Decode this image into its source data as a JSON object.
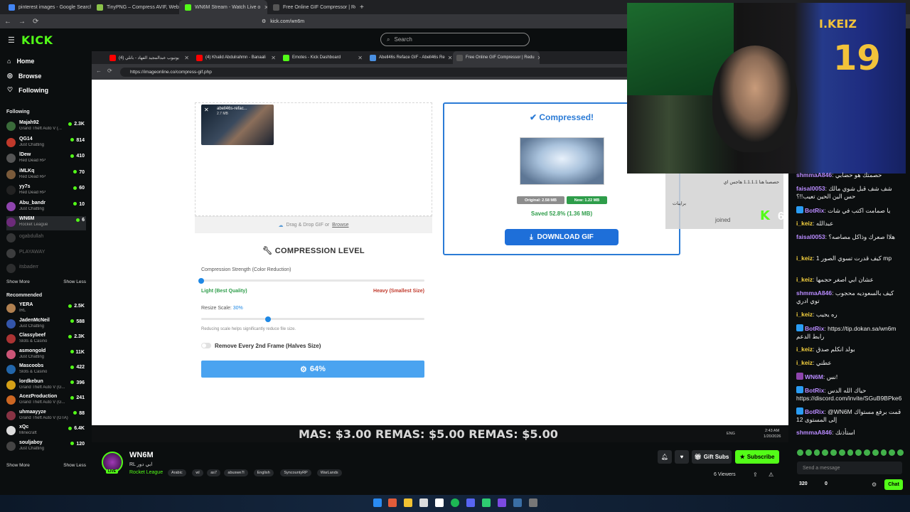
{
  "outer_tabs": [
    {
      "label": "pinterest images - Google Search",
      "color": "#4285f4"
    },
    {
      "label": "TinyPNG – Compress AVIF, WebP, PNG",
      "color": "#8bc34a"
    },
    {
      "label": "WN6M Stream - Watch Live o",
      "color": "#53fc18"
    },
    {
      "label": "Free Online GIF Compressor | Reduc",
      "color": "#555555"
    }
  ],
  "outer_url": "kick.com/wn6m",
  "kick": {
    "logo": "KICK",
    "search_placeholder": "Search"
  },
  "sidebar": {
    "nav": [
      {
        "label": "Home"
      },
      {
        "label": "Browse"
      },
      {
        "label": "Following"
      }
    ],
    "following_title": "Following",
    "following": [
      {
        "name": "Majah92",
        "game": "Grand Theft Auto V (...",
        "viewers": "2.3K",
        "color": "#3a6b3a"
      },
      {
        "name": "QG14",
        "game": "Just Chatting",
        "viewers": "814",
        "color": "#c0392b"
      },
      {
        "name": "lDew",
        "game": "Red Dead RP",
        "viewers": "410",
        "color": "#555555"
      },
      {
        "name": "iMLKq",
        "game": "Red Dead RP",
        "viewers": "70",
        "color": "#7a5a3a"
      },
      {
        "name": "yy7s",
        "game": "Red Dead RP",
        "viewers": "60",
        "color": "#222222"
      },
      {
        "name": "Abu_bandr",
        "game": "Just Chatting",
        "viewers": "10",
        "color": "#8e44ad"
      },
      {
        "name": "WN6M",
        "game": "Rocket League",
        "viewers": "6",
        "color": "#6d2b7a"
      }
    ],
    "offline": [
      {
        "name": "ogabdullah",
        "color": "#666666"
      },
      {
        "name": "PLAYAWAY",
        "color": "#777777"
      },
      {
        "name": "itsbaderr",
        "color": "#555555"
      }
    ],
    "show_more": "Show More",
    "show_less": "Show Less",
    "recommended_title": "Recommended",
    "recommended": [
      {
        "name": "YERA",
        "game": "IRL",
        "viewers": "2.5K",
        "color": "#b08050"
      },
      {
        "name": "JadenMcNeil",
        "game": "Just Chatting",
        "viewers": "588",
        "color": "#3355aa"
      },
      {
        "name": "Classybeef",
        "game": "Slots & Casino",
        "viewers": "2.3K",
        "color": "#aa3333"
      },
      {
        "name": "asmongold",
        "game": "Just Chatting",
        "viewers": "11K",
        "color": "#cc5577"
      },
      {
        "name": "Mascoobs",
        "game": "Slots & Casino",
        "viewers": "422",
        "color": "#2266aa"
      },
      {
        "name": "lordkebun",
        "game": "Grand Theft Auto V (G...",
        "viewers": "396",
        "color": "#d4a017"
      },
      {
        "name": "AcezProduction",
        "game": "Grand Theft Auto V (G...",
        "viewers": "241",
        "color": "#cc6622"
      },
      {
        "name": "uhmaayyze",
        "game": "Grand Theft Auto V (GTA)",
        "viewers": "88",
        "color": "#883344"
      },
      {
        "name": "xQc",
        "game": "Minecraft",
        "viewers": "6.4K",
        "color": "#dddddd"
      },
      {
        "name": "souljaboy",
        "game": "Just Chatting",
        "viewers": "120",
        "color": "#444444"
      }
    ],
    "tooltip": "RL ابي دور"
  },
  "inner_browser": {
    "tabs": [
      {
        "label": "يوتيوب عبدالمجيد الفهاد - بانلي (4)",
        "color": "#ff0000"
      },
      {
        "label": "(4) Khalid Abdulrahmn - Banaali",
        "color": "#ff0000"
      },
      {
        "label": "Emotes - Kick Dashboard",
        "color": "#53fc18"
      },
      {
        "label": "Abell46s Reface GIF - Abell46s Re",
        "color": "#4a90e2"
      },
      {
        "label": "Free Online GIF Compressor | Redu",
        "color": "#555555"
      }
    ],
    "url": "https://imageonline.co/compress-gif.php"
  },
  "compressor": {
    "file_name": "abell46s-refac...",
    "file_size": "2.7 MB",
    "drop_text": "Drag & Drop GIF or",
    "browse": "Browse",
    "section_title": "COMPRESSION LEVEL",
    "strength_label": "Compression Strength (Color Reduction)",
    "strength_value": 0,
    "light_label": "Light (Best Quality)",
    "heavy_label": "Heavy (Smallest Size)",
    "resize_label": "Resize Scale:",
    "resize_value": "30%",
    "resize_fraction": 0.3,
    "resize_hint": "Reducing scale helps significantly reduce file size.",
    "toggle_label": "Remove Every 2nd Frame (Halves Size)",
    "progress_label": "64%",
    "result_title": "Compressed!",
    "original": "Original: 2.58 MB",
    "new": "New: 1.22 MB",
    "saved": "Saved 52.8% (1.36 MB)",
    "download": "DOWNLOAD GIF"
  },
  "ticker": "MAS: $3.00 REMAS: $5.00 REMAS: $5.00",
  "tray": {
    "lang": "ENG",
    "time": "2:43 AM",
    "date": "1/20/2026"
  },
  "stream": {
    "name": "WN6M",
    "title": "RL ابي دور",
    "category": "Rocket League",
    "live": "LIVE",
    "tags": [
      "Arabic",
      "wl",
      "as7",
      "abuswe7l",
      "English",
      "SyncountyRP",
      "WarLands"
    ],
    "gift": "Gift Subs",
    "subscribe": "Subscribe",
    "viewers": "6 Viewers"
  },
  "webcam": {
    "jersey_name": "I.KEIZ",
    "jersey_number": "19"
  },
  "alert": {
    "line1": "حصصنا هنا 1.1.1.1 هاجس اي",
    "line2": "برايبات",
    "joined": "joined",
    "count": "6"
  },
  "chat": [
    {
      "user": "shmmaA846",
      "text": ": حصمتك هو حضابي",
      "color": "#b98bff",
      "badge": ""
    },
    {
      "user": "faisal0053",
      "text": ": شف شف قبل شوي مالك حس الين الحين تعيب!!؟",
      "color": "#b98bff",
      "badge": ""
    },
    {
      "user": "BotRix",
      "text": ": يا صمامت اكتب في شات",
      "color": "#b98bff",
      "badge": "#2a9df4"
    },
    {
      "user": "i_keiz",
      "text": ": عبدالله",
      "color": "#f4d03f",
      "badge": ""
    },
    {
      "user": "faisal0053",
      "text": ": هلاا صعرك وذاكل مصاصه؟",
      "color": "#b98bff",
      "badge": ""
    },
    {
      "user": "i_keiz",
      "text": ": كيف قدرت تسوي الصور 1 mp",
      "color": "#f4d03f",
      "badge": ""
    },
    {
      "user": "i_keiz",
      "text": ": عشان ابي اصغر حجمها",
      "color": "#f4d03f",
      "badge": ""
    },
    {
      "user": "shmmaA846",
      "text": ": كيف بالسعوديه محجوب توي ادري",
      "color": "#b98bff",
      "badge": ""
    },
    {
      "user": "i_keiz",
      "text": ": ره يجيب",
      "color": "#f4d03f",
      "badge": ""
    },
    {
      "user": "BotRix",
      "text": ": https://tip.dokan.sa/wn6m رابط الدعم",
      "color": "#b98bff",
      "badge": "#2a9df4"
    },
    {
      "user": "i_keiz",
      "text": ": بولد انكلم صدق",
      "color": "#f4d03f",
      "badge": ""
    },
    {
      "user": "i_keiz",
      "text": ": عطني",
      "color": "#f4d03f",
      "badge": ""
    },
    {
      "user": "WN6M",
      "text": ": نس!",
      "color": "#b98bff",
      "badge": "#8e44ad"
    },
    {
      "user": "BotRix",
      "text": ": حياك الله الدس https://discord.com/invite/SGuB9BPke6",
      "color": "#b98bff",
      "badge": "#2a9df4"
    },
    {
      "user": "BotRix",
      "text": ": @WN6M قمت برفع مستواك إلى المستوى 12",
      "color": "#b98bff",
      "badge": "#2a9df4"
    },
    {
      "user": "shmmaA846",
      "text": ": استأذنك",
      "color": "#b98bff",
      "badge": ""
    }
  ],
  "chat_input_placeholder": "Send a message",
  "points": "320",
  "points2": "0",
  "chat_button": "Chat"
}
